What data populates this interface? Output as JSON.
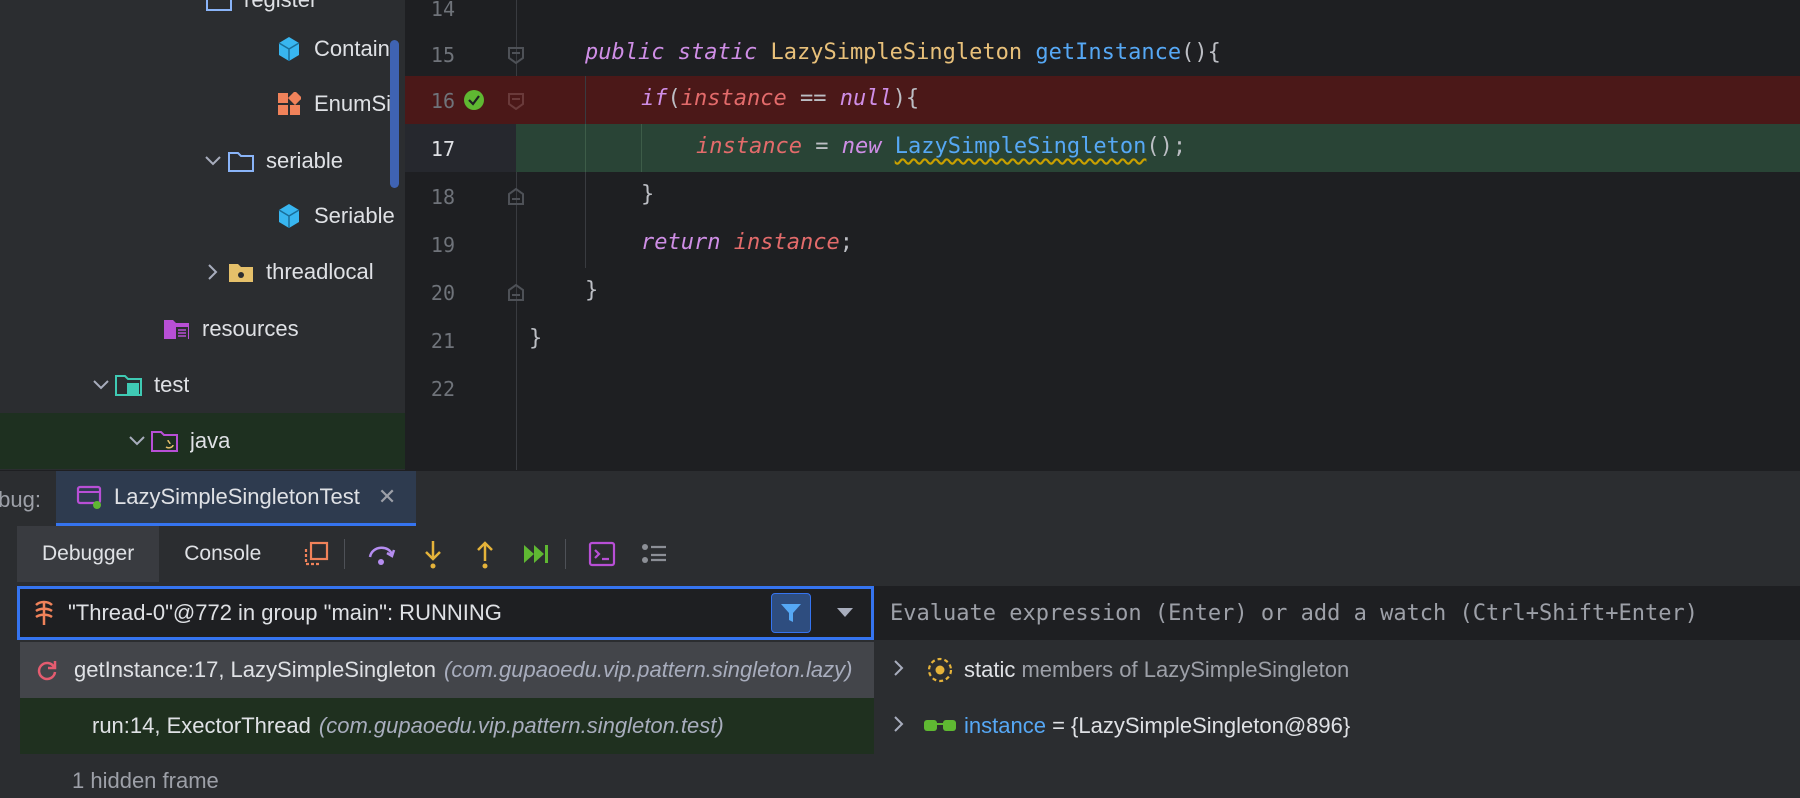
{
  "project_tree": {
    "items": [
      {
        "label": "register",
        "icon": "folder-icon"
      },
      {
        "label": "ContainerSingleton",
        "icon": "class-icon"
      },
      {
        "label": "EnumSingleton",
        "icon": "enum-icon"
      },
      {
        "label": "seriable",
        "icon": "folder-icon"
      },
      {
        "label": "SeriableSingleton",
        "icon": "class-icon"
      },
      {
        "label": "threadlocal",
        "icon": "folder-icon"
      },
      {
        "label": "resources",
        "icon": "resources-folder-icon"
      },
      {
        "label": "test",
        "icon": "test-folder-icon"
      },
      {
        "label": "java",
        "icon": "java-source-folder-icon"
      }
    ]
  },
  "editor": {
    "line_numbers": [
      "14",
      "15",
      "16",
      "17",
      "18",
      "19",
      "20",
      "21",
      "22"
    ],
    "current_line": "17",
    "code": {
      "l15_kw1": "public",
      "l15_kw2": "static",
      "l15_type": "LazySimpleSingleton",
      "l15_method": "getInstance",
      "l15_tail": "(){",
      "l16_kw": "if",
      "l16_open": "(",
      "l16_field": "instance",
      "l16_op": " == ",
      "l16_null": "null",
      "l16_tail": "){",
      "l17_field": "instance",
      "l17_op": " = ",
      "l17_new": "new",
      "l17_type": "LazySimpleSingleton",
      "l17_tail": "();",
      "l18_brace": "}",
      "l19_kw": "return",
      "l19_field": "instance",
      "l19_tail": ";",
      "l20_brace": "}",
      "l21_brace": "}"
    }
  },
  "debug": {
    "label": "Debug:",
    "run_tab": "LazySimpleSingletonTest",
    "tabs": {
      "debugger": "Debugger",
      "console": "Console"
    },
    "thread": "\"Thread-0\"@772 in group \"main\": RUNNING",
    "frames": [
      {
        "method": "getInstance:17, LazySimpleSingleton",
        "package": "(com.gupaoedu.vip.pattern.singleton.lazy)"
      },
      {
        "method": "run:14, ExectorThread",
        "package": "(com.gupaoedu.vip.pattern.singleton.test)"
      }
    ],
    "hidden_frames": "1 hidden frame",
    "evaluate_placeholder": "Evaluate expression (Enter) or add a watch (Ctrl+Shift+Enter)",
    "variables": {
      "static_prefix": "static",
      "static_suffix": "members of LazySimpleSingleton",
      "instance_name": "instance",
      "instance_value": "= {LazySimpleSingleton@896}"
    }
  },
  "colors": {
    "accent": "#3574f0",
    "breakpoint_line": "#4b1818",
    "execution_line": "#294436"
  }
}
